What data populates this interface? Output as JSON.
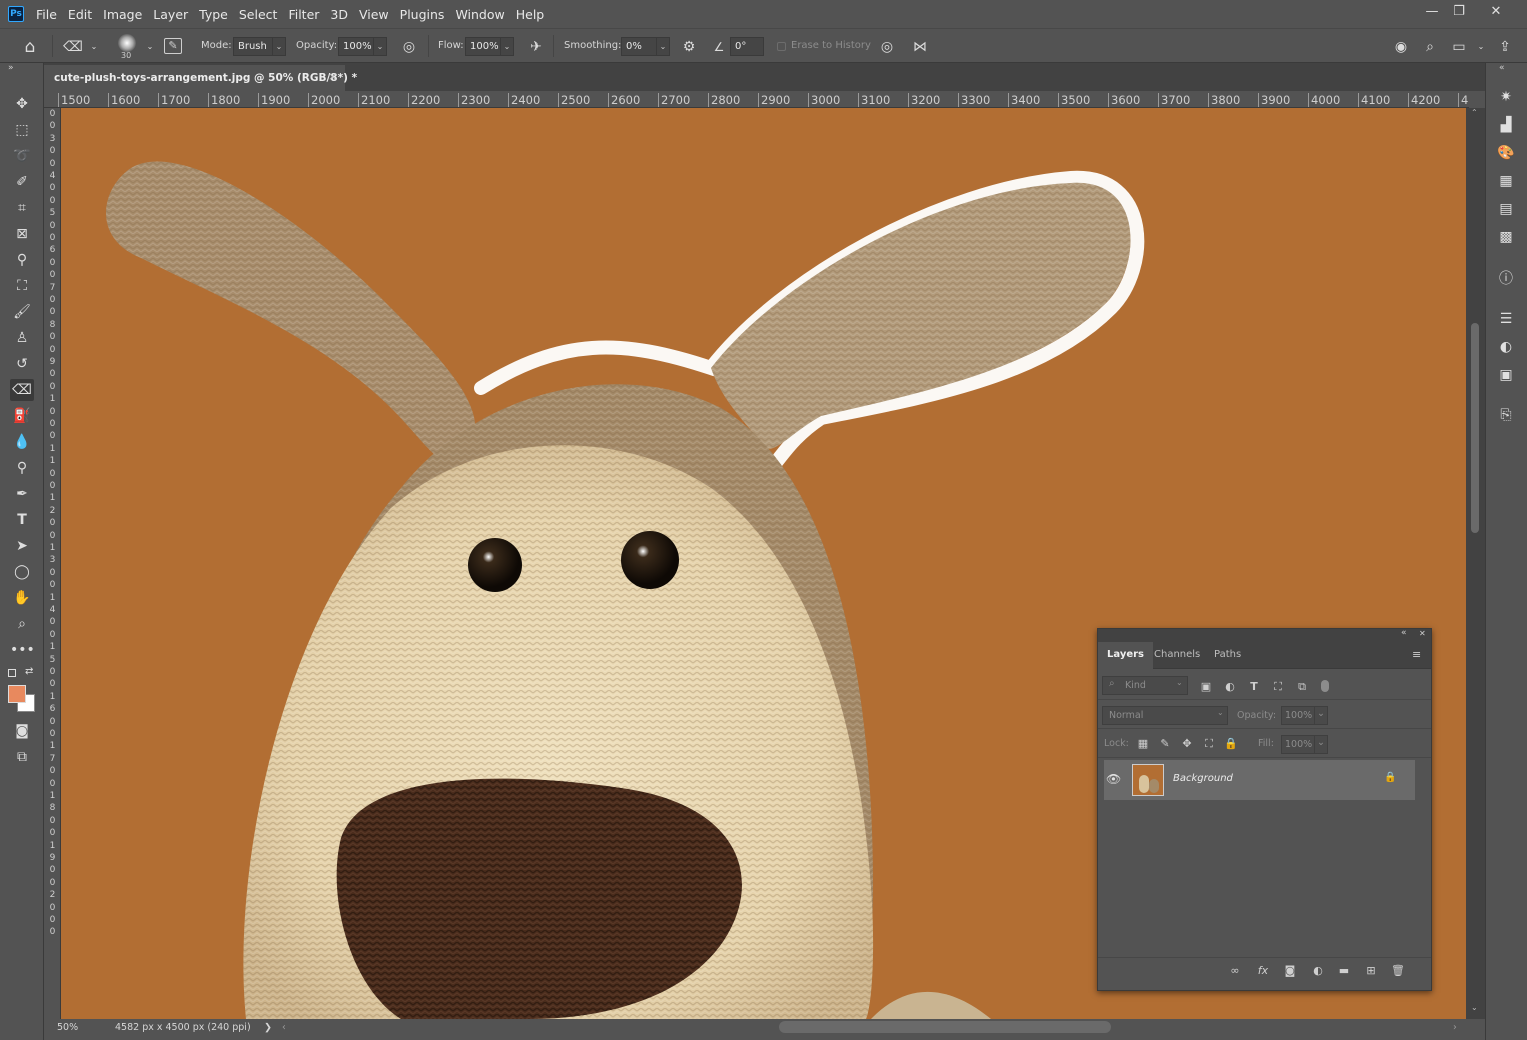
{
  "menu": {
    "items": [
      "File",
      "Edit",
      "Image",
      "Layer",
      "Type",
      "Select",
      "Filter",
      "3D",
      "View",
      "Plugins",
      "Window",
      "Help"
    ],
    "logo": "Ps",
    "window_controls": [
      "—",
      "❐",
      "✕"
    ]
  },
  "options": {
    "brush_size": "30",
    "mode_label": "Mode:",
    "mode_value": "Brush",
    "opacity_label": "Opacity:",
    "opacity_value": "100%",
    "flow_label": "Flow:",
    "flow_value": "100%",
    "smoothing_label": "Smoothing:",
    "smoothing_value": "0%",
    "angle_value": "0°",
    "erase_history_label": "Erase to History"
  },
  "document": {
    "tab_title": "cute-plush-toys-arrangement.jpg @ 50% (RGB/8*) *",
    "close": "×"
  },
  "ruler": {
    "h_ticks": [
      "1500",
      "1600",
      "1700",
      "1800",
      "1900",
      "2000",
      "2100",
      "2200",
      "2300",
      "2400",
      "2500",
      "2600",
      "2700",
      "2800",
      "2900",
      "3000",
      "3100",
      "3200",
      "3300",
      "3400",
      "3500",
      "3600",
      "3700",
      "3800",
      "3900",
      "4000",
      "4100",
      "4200",
      "4"
    ],
    "v_ticks": [
      "0",
      "0",
      "3",
      "0",
      "0",
      "4",
      "0",
      "0",
      "5",
      "0",
      "0",
      "6",
      "0",
      "0",
      "7",
      "0",
      "0",
      "8",
      "0",
      "0",
      "9",
      "0",
      "0",
      "1",
      "0",
      "0",
      "0",
      "1",
      "1",
      "0",
      "0",
      "1",
      "2",
      "0",
      "0",
      "1",
      "3",
      "0",
      "0",
      "1",
      "4",
      "0",
      "0",
      "1",
      "5",
      "0",
      "0",
      "1",
      "6",
      "0",
      "0",
      "1",
      "7",
      "0",
      "0",
      "1",
      "8",
      "0",
      "0",
      "1",
      "9",
      "0",
      "0",
      "2",
      "0",
      "0",
      "0"
    ]
  },
  "status": {
    "zoom": "50%",
    "doc_size": "4582 px x 4500 px (240 ppi)",
    "arrow": "❯"
  },
  "layers_panel": {
    "tabs": [
      "Layers",
      "Channels",
      "Paths"
    ],
    "filter_placeholder": "Kind",
    "blend_mode": "Normal",
    "opacity_label": "Opacity:",
    "opacity_value": "100%",
    "lock_label": "Lock:",
    "fill_label": "Fill:",
    "fill_value": "100%",
    "layer_name": "Background",
    "collapse": "«",
    "close": "✕"
  },
  "colors": {
    "canvas_bg": "#b26e33",
    "foreground": "#e8895e",
    "background": "#ffffff",
    "ui_dark": "#535353"
  }
}
